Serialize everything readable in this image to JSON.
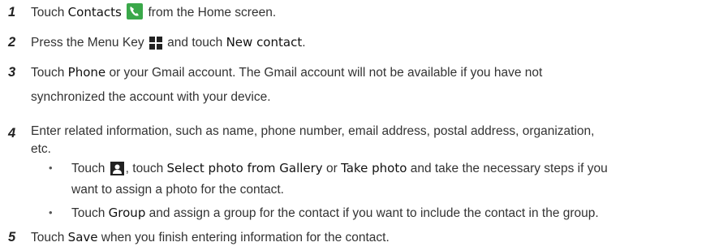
{
  "steps": [
    {
      "number": "1",
      "before": "Touch ",
      "bold": "Contacts",
      "icon": "phone-contacts-icon",
      "after": " from the Home screen."
    },
    {
      "number": "2",
      "before": "Press the Menu Key ",
      "icon": "menu-key-icon",
      "mid": " and touch ",
      "bold": "New contact",
      "after": "."
    },
    {
      "number": "3",
      "before": "Touch ",
      "bold": "Phone",
      "after_line1": " or your Gmail account. The Gmail account will not be available if you have not",
      "line2": "synchronized the account with your device."
    },
    {
      "number": "4",
      "line1": "Enter related information, such as name, phone number, email address, postal address, organization,",
      "line2": "etc.",
      "bullets": [
        {
          "t1": "Touch ",
          "icon": "contact-photo-icon",
          "t2": ", touch ",
          "b1": "Select photo from Gallery",
          "t3": " or ",
          "b2": "Take photo",
          "t4": " and take the necessary steps if you",
          "line2": "want to assign a photo for the contact."
        },
        {
          "t1": "Touch ",
          "b1": "Group",
          "t2": " and assign a group for the contact if you want to include the contact in the group."
        }
      ]
    },
    {
      "number": "5",
      "before": "Touch ",
      "bold": "Save",
      "after": " when you finish entering information for the contact."
    }
  ],
  "colors": {
    "icon_green": "#3aa84a",
    "icon_dark": "#222222"
  }
}
